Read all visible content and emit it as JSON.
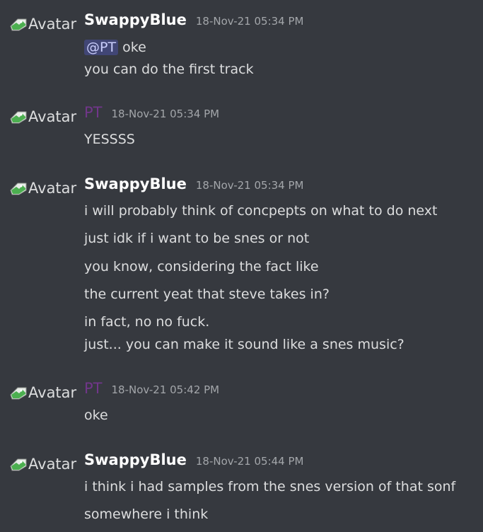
{
  "avatar_alt": "Avatar",
  "messages": [
    {
      "author": "SwappyBlue",
      "author_color": "#ffffff",
      "timestamp": "18-Nov-21 05:34 PM",
      "lines": [
        {
          "mention": "@PT",
          "text": "oke"
        },
        {
          "text": "you can do the first track"
        }
      ]
    },
    {
      "author": "PT",
      "author_color": "#71368a",
      "timestamp": "18-Nov-21 05:34 PM",
      "lines": [
        {
          "text": "YESSSS"
        }
      ]
    },
    {
      "author": "SwappyBlue",
      "author_color": "#ffffff",
      "timestamp": "18-Nov-21 05:34 PM",
      "lines": [
        {
          "text": "i will probably think of concpepts on what to do next"
        },
        {
          "text": "just idk if i want to be snes or not"
        },
        {
          "text": "you know, considering the fact like"
        },
        {
          "text": "the current yeat that steve takes in?"
        },
        {
          "text": "in fact, no no fuck."
        },
        {
          "text": "just... you can make it sound like a snes music?"
        }
      ]
    },
    {
      "author": "PT",
      "author_color": "#71368a",
      "timestamp": "18-Nov-21 05:42 PM",
      "lines": [
        {
          "text": "oke"
        }
      ]
    },
    {
      "author": "SwappyBlue",
      "author_color": "#ffffff",
      "timestamp": "18-Nov-21 05:44 PM",
      "lines": [
        {
          "text": "i think i had samples from the snes version of that sonf"
        },
        {
          "text": "somewhere i think"
        }
      ]
    }
  ]
}
